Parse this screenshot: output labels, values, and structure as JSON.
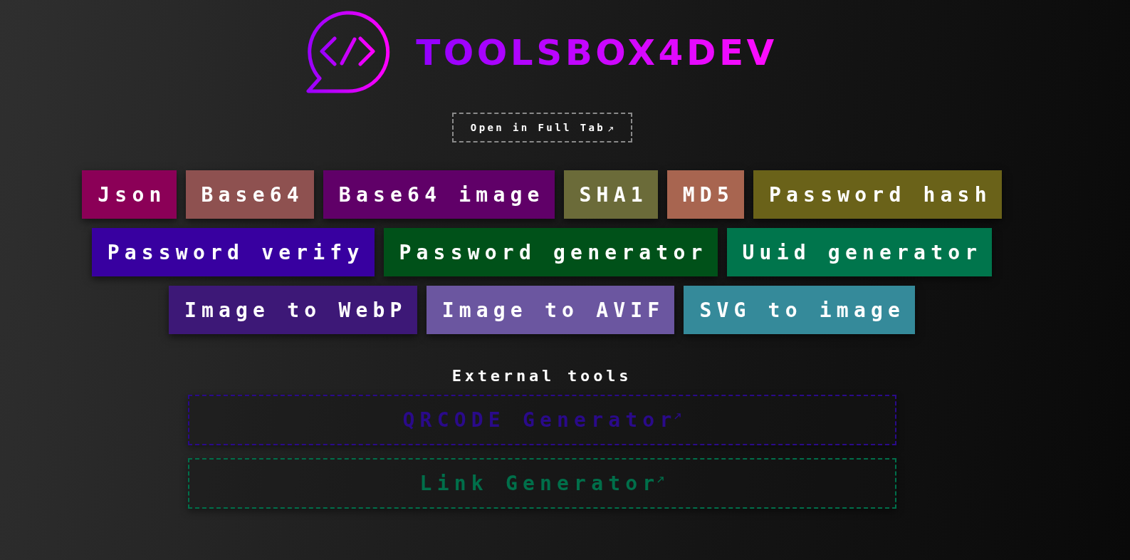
{
  "header": {
    "logo_text": "TOOLSBOX4DEV",
    "open_button": {
      "label": "Open in Full Tab"
    }
  },
  "tool_rows": [
    [
      {
        "label": "Json",
        "color": "#8b0057"
      },
      {
        "label": "Base64",
        "color": "#8e5150"
      },
      {
        "label": "Base64 image",
        "color": "#600068"
      },
      {
        "label": "SHA1",
        "color": "#6b6b39"
      },
      {
        "label": "MD5",
        "color": "#a86550"
      },
      {
        "label": "Password hash",
        "color": "#6a6219"
      }
    ],
    [
      {
        "label": "Password verify",
        "color": "#3800a0"
      },
      {
        "label": "Password generator",
        "color": "#005119"
      },
      {
        "label": "Uuid generator",
        "color": "#00754c"
      }
    ],
    [
      {
        "label": "Image to WebP",
        "color": "#3d1877"
      },
      {
        "label": "Image to AVIF",
        "color": "#6b56a0"
      },
      {
        "label": "SVG to image",
        "color": "#358a9a"
      }
    ]
  ],
  "external": {
    "title": "External tools",
    "links": [
      {
        "label": "QRCODE Generator",
        "color": "#2a0a8a"
      },
      {
        "label": "Link Generator",
        "color": "#006f4a"
      }
    ]
  }
}
